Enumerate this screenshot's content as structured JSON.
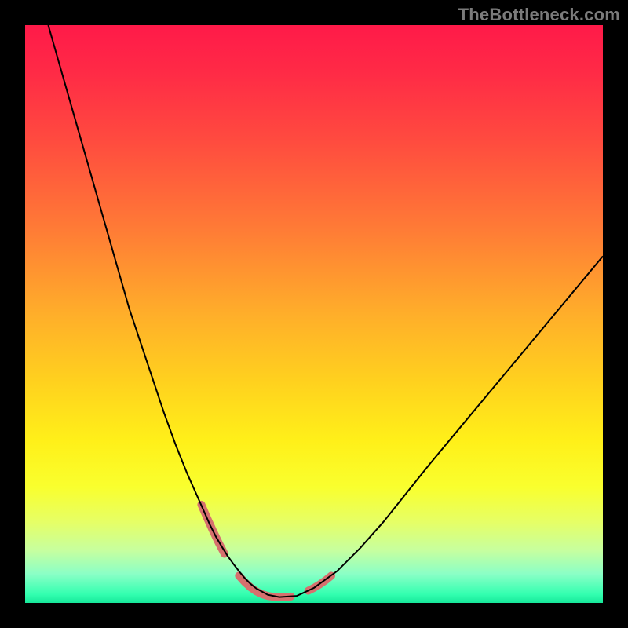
{
  "watermark": "TheBottleneck.com",
  "chart_data": {
    "type": "line",
    "title": "",
    "xlabel": "",
    "ylabel": "",
    "xlim": [
      0,
      100
    ],
    "ylim": [
      0,
      100
    ],
    "background_gradient": {
      "stops": [
        {
          "offset": 0.0,
          "color": "#ff1a49"
        },
        {
          "offset": 0.08,
          "color": "#ff2a46"
        },
        {
          "offset": 0.2,
          "color": "#ff4b3f"
        },
        {
          "offset": 0.35,
          "color": "#ff7a36"
        },
        {
          "offset": 0.5,
          "color": "#ffae2a"
        },
        {
          "offset": 0.62,
          "color": "#ffd21e"
        },
        {
          "offset": 0.72,
          "color": "#fff019"
        },
        {
          "offset": 0.8,
          "color": "#f9ff2e"
        },
        {
          "offset": 0.86,
          "color": "#e6ff66"
        },
        {
          "offset": 0.91,
          "color": "#c6ffa0"
        },
        {
          "offset": 0.95,
          "color": "#8affc6"
        },
        {
          "offset": 0.985,
          "color": "#33ffb0"
        },
        {
          "offset": 1.0,
          "color": "#17e89a"
        }
      ]
    },
    "series": [
      {
        "name": "bottleneck-curve",
        "color": "#000000",
        "width": 2,
        "x": [
          4,
          6,
          8,
          10,
          12,
          14,
          16,
          18,
          20,
          22,
          24,
          26,
          28,
          30,
          32,
          33,
          34,
          35,
          36,
          37,
          38,
          39,
          40,
          42,
          44,
          47,
          50,
          54,
          58,
          62,
          66,
          70,
          75,
          80,
          85,
          90,
          95,
          100
        ],
        "y": [
          100,
          93,
          86,
          79,
          72,
          65,
          58,
          51,
          45,
          39,
          33,
          27.5,
          22.5,
          18,
          13.5,
          11.5,
          9.8,
          8.2,
          6.8,
          5.5,
          4.3,
          3.3,
          2.5,
          1.4,
          1.0,
          1.2,
          2.6,
          5.5,
          9.5,
          14,
          19,
          24,
          30,
          36,
          42,
          48,
          54,
          60
        ]
      }
    ],
    "highlight_segments": [
      {
        "name": "left-falling-highlight",
        "color": "#d6706e",
        "width": 10,
        "x": [
          30.5,
          31.5,
          32.5,
          33.5,
          34.5
        ],
        "y": [
          17.0,
          14.7,
          12.5,
          10.4,
          8.5
        ]
      },
      {
        "name": "valley-highlight",
        "color": "#d6706e",
        "width": 10,
        "x": [
          37,
          38,
          39,
          40,
          41,
          42,
          43,
          44,
          45,
          46
        ],
        "y": [
          4.7,
          3.6,
          2.7,
          2.0,
          1.5,
          1.2,
          1.05,
          1.0,
          1.02,
          1.1
        ]
      },
      {
        "name": "right-rising-highlight",
        "color": "#d6706e",
        "width": 10,
        "x": [
          49,
          50,
          51,
          52,
          53
        ],
        "y": [
          2.1,
          2.6,
          3.2,
          3.9,
          4.7
        ]
      }
    ]
  }
}
